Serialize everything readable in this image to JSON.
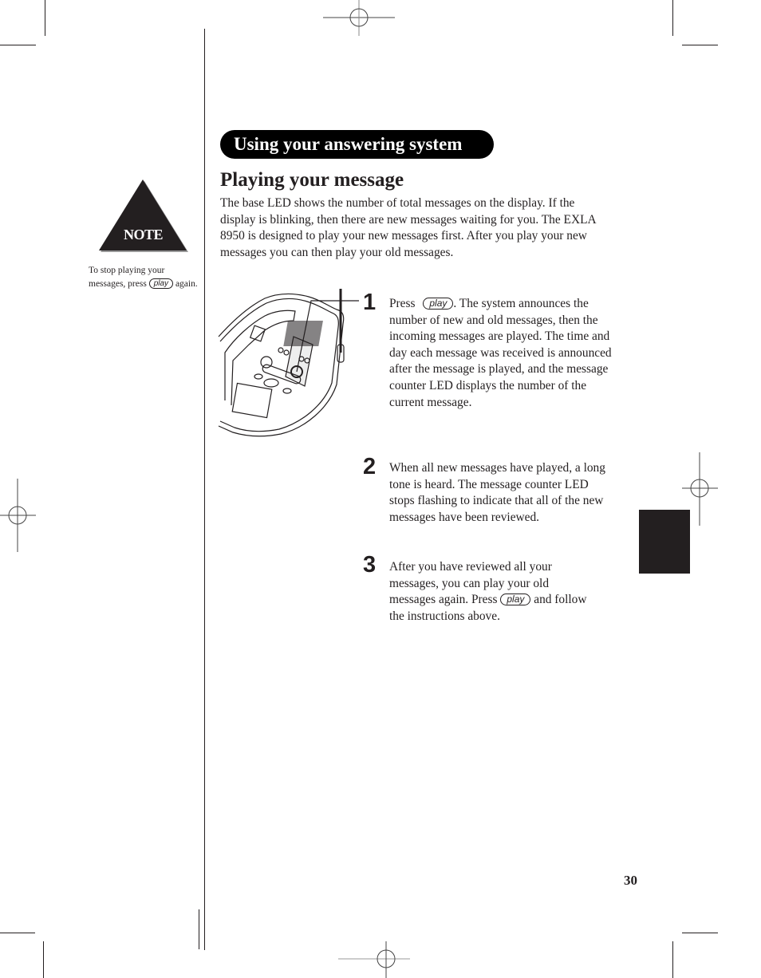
{
  "section_header": "Using your answering system",
  "page_title": "Playing your message",
  "intro_text": "The base LED shows the number of total messages on the display. If the display is blinking, then there are new messages waiting for you.  The EXLA 8950 is designed to play your new messages first. After you play your new messages you can then play your old messages.",
  "note": {
    "label": "NOTE",
    "text_before": "To stop playing your messages, press",
    "key": "play",
    "text_after": "again."
  },
  "steps": [
    {
      "number": "1",
      "text_before": "Press",
      "key": "play",
      "text_after": ". The system announces the number of new and old messages, then the incoming messages are played. The time and day each message was received is announced after the message is played, and the message counter LED displays the number of the current message."
    },
    {
      "number": "2",
      "text": "When all new messages have played, a long tone is heard. The message counter LED stops flashing to indicate that all of the new messages have been reviewed."
    },
    {
      "number": "3",
      "text_before": "After you have reviewed all your messages, you can play your old messages again. Press",
      "key": "play",
      "text_after": "and follow the instructions above."
    }
  ],
  "illustration": {
    "icon": "answering-machine-base-icon",
    "callout": "1"
  },
  "page_number": "30",
  "colors": {
    "ink": "#231f20",
    "pill": "#000000",
    "background": "#ffffff"
  }
}
